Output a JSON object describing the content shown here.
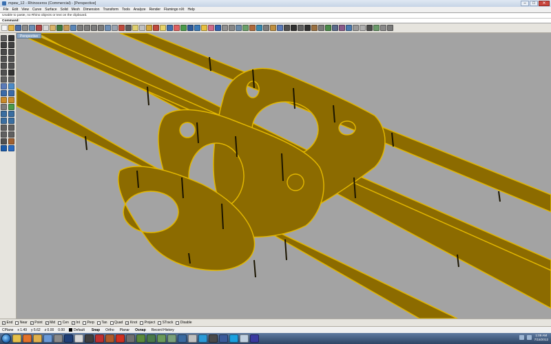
{
  "window": {
    "title": "mpsw_12 - Rhinoceros (Commercial) - [Perspective]",
    "minimize_glyph": "–",
    "maximize_glyph": "□",
    "close_glyph": "✕"
  },
  "menu": [
    "File",
    "Edit",
    "View",
    "Curve",
    "Surface",
    "Solid",
    "Mesh",
    "Dimension",
    "Transform",
    "Tools",
    "Analyze",
    "Render",
    "Flamingo nXt",
    "Help"
  ],
  "command": {
    "history": "Unable to paste, no Rhino objects or text on the clipboard.",
    "prompt": "Command:",
    "value": ""
  },
  "toolbar_top": {
    "icons": [
      {
        "name": "new-icon",
        "color": "#f4f4f4"
      },
      {
        "name": "open-icon",
        "color": "#e4b545"
      },
      {
        "name": "save-icon",
        "color": "#4a6ea8"
      },
      {
        "name": "print-icon",
        "color": "#8a8a8a"
      },
      {
        "name": "import-icon",
        "color": "#6c8fb5"
      },
      {
        "name": "cut-icon",
        "color": "#b04646"
      },
      {
        "name": "copy-icon",
        "color": "#d8d8d8"
      },
      {
        "name": "paste-icon",
        "color": "#d9b46a"
      },
      {
        "name": "undo-icon",
        "color": "#3e7a3e"
      },
      {
        "name": "pan-icon",
        "color": "#c89a56"
      },
      {
        "name": "rotate-view-icon",
        "color": "#5a86b8"
      },
      {
        "name": "zoom-icon",
        "color": "#7c7c7c"
      },
      {
        "name": "zoom-window-icon",
        "color": "#7c7c7c"
      },
      {
        "name": "zoom-extents-icon",
        "color": "#7c7c7c"
      },
      {
        "name": "zoom-selected-icon",
        "color": "#7c7c7c"
      },
      {
        "name": "four-views-icon",
        "color": "#6e8fb6"
      },
      {
        "name": "grid-icon",
        "color": "#9aa4b0"
      },
      {
        "name": "perspective-icon",
        "color": "#c04a3c"
      },
      {
        "name": "select-icon",
        "color": "#5c5c5c"
      },
      {
        "name": "show-icon",
        "color": "#e0d070"
      },
      {
        "name": "hide-icon",
        "color": "#c0c0c0"
      },
      {
        "name": "lock-icon",
        "color": "#d4a83c"
      },
      {
        "name": "layer-icon",
        "color": "#c04a3c"
      },
      {
        "name": "light-icon",
        "color": "#e8d36a"
      },
      {
        "name": "properties-icon",
        "color": "#3f6fb0"
      },
      {
        "name": "color-wheel-icon",
        "color": "#e06060"
      },
      {
        "name": "render-icon",
        "color": "#4a9a4a"
      },
      {
        "name": "material-icon",
        "color": "#2c5a9a"
      },
      {
        "name": "environment-icon",
        "color": "#3a7ab8"
      },
      {
        "name": "sun-icon",
        "color": "#e8c040"
      },
      {
        "name": "flamingo-icon",
        "color": "#d06a8a"
      },
      {
        "name": "help-icon",
        "color": "#2f62b0"
      },
      {
        "name": "options-icon",
        "color": "#909090"
      },
      {
        "name": "osnap-icon",
        "color": "#888888"
      },
      {
        "name": "planar-icon",
        "color": "#6a8aa8"
      },
      {
        "name": "history-icon",
        "color": "#6aa06a"
      },
      {
        "name": "analyze-icon",
        "color": "#b06a3a"
      },
      {
        "name": "curvature-icon",
        "color": "#3a8ab0"
      },
      {
        "name": "mesh-icon",
        "color": "#7c7c7c"
      },
      {
        "name": "solid-icon",
        "color": "#c09040"
      },
      {
        "name": "surface-icon",
        "color": "#5a7ab8"
      },
      {
        "name": "curve-icon",
        "color": "#505050"
      },
      {
        "name": "point-icon",
        "color": "#303030"
      },
      {
        "name": "dimension-icon",
        "color": "#606060"
      },
      {
        "name": "text-icon",
        "color": "#303030"
      },
      {
        "name": "block-icon",
        "color": "#9a7040"
      },
      {
        "name": "group-icon",
        "color": "#7a7a7a"
      },
      {
        "name": "transform-icon",
        "color": "#4a8a4a"
      },
      {
        "name": "array-icon",
        "color": "#5a6a8a"
      },
      {
        "name": "mirror-icon",
        "color": "#8a5a8a"
      },
      {
        "name": "scale-icon",
        "color": "#4a7ab0"
      },
      {
        "name": "align-icon",
        "color": "#9a9a9a"
      },
      {
        "name": "snapshot-icon",
        "color": "#b0b0b0"
      },
      {
        "name": "script-icon",
        "color": "#4c4c4c"
      },
      {
        "name": "plugin-icon",
        "color": "#6a9a6a"
      },
      {
        "name": "toolbar-icon",
        "color": "#8a8a8a"
      },
      {
        "name": "more-icon",
        "color": "#7a7a7a"
      }
    ]
  },
  "toolbar_left": {
    "icons": [
      {
        "name": "select-arrow-icon",
        "color": "#5c5c5c"
      },
      {
        "name": "point-tool-icon",
        "color": "#303030"
      },
      {
        "name": "line-tool-icon",
        "color": "#404040"
      },
      {
        "name": "polyline-tool-icon",
        "color": "#404040"
      },
      {
        "name": "curve-tool-icon",
        "color": "#4a4a4a"
      },
      {
        "name": "freeform-tool-icon",
        "color": "#4a4a4a"
      },
      {
        "name": "circle-tool-icon",
        "color": "#505050"
      },
      {
        "name": "arc-tool-icon",
        "color": "#505050"
      },
      {
        "name": "ellipse-tool-icon",
        "color": "#505050"
      },
      {
        "name": "rectangle-tool-icon",
        "color": "#505050"
      },
      {
        "name": "polygon-tool-icon",
        "color": "#505050"
      },
      {
        "name": "text-tool-icon",
        "color": "#303030"
      },
      {
        "name": "fillet-tool-icon",
        "color": "#606060"
      },
      {
        "name": "offset-tool-icon",
        "color": "#606060"
      },
      {
        "name": "surface-tool-icon",
        "color": "#5a7ab8"
      },
      {
        "name": "loft-tool-icon",
        "color": "#4a8ac8"
      },
      {
        "name": "box-tool-icon",
        "color": "#3a6aa8"
      },
      {
        "name": "sphere-tool-icon",
        "color": "#3a6aa8"
      },
      {
        "name": "extrude-tool-icon",
        "color": "#c88a2a"
      },
      {
        "name": "boolean-tool-icon",
        "color": "#c88a2a"
      },
      {
        "name": "mesh-tool-icon",
        "color": "#7c7c7c"
      },
      {
        "name": "render-tool-icon",
        "color": "#4a9a4a"
      },
      {
        "name": "move-tool-icon",
        "color": "#3a6ea0"
      },
      {
        "name": "copy-tool-icon",
        "color": "#3a6ea0"
      },
      {
        "name": "rotate-tool-icon",
        "color": "#3a6ea0"
      },
      {
        "name": "scale-tool-icon",
        "color": "#3a6ea0"
      },
      {
        "name": "split-tool-icon",
        "color": "#606060"
      },
      {
        "name": "trim-tool-icon",
        "color": "#606060"
      },
      {
        "name": "join-tool-icon",
        "color": "#606060"
      },
      {
        "name": "explode-tool-icon",
        "color": "#606060"
      },
      {
        "name": "dimension-tool-icon",
        "color": "#505050"
      },
      {
        "name": "analyze-tool-icon",
        "color": "#a06030"
      },
      {
        "name": "gear-icon",
        "color": "#1a5aa8"
      },
      {
        "name": "settings-tool-icon",
        "color": "#2a6ac0"
      }
    ]
  },
  "viewport": {
    "label": "Perspective",
    "background": "#a3a3a3",
    "part_color": "#8c6b00",
    "edge_color": "#e2b700"
  },
  "osnap": {
    "items": [
      {
        "label": "End",
        "checked": true
      },
      {
        "label": "Near",
        "checked": false
      },
      {
        "label": "Point",
        "checked": true
      },
      {
        "label": "Mid",
        "checked": true
      },
      {
        "label": "Cen",
        "checked": false
      },
      {
        "label": "Int",
        "checked": true
      },
      {
        "label": "Perp",
        "checked": false
      },
      {
        "label": "Tan",
        "checked": false
      },
      {
        "label": "Quad",
        "checked": false
      },
      {
        "label": "Knot",
        "checked": true
      },
      {
        "label": "Project",
        "checked": false
      },
      {
        "label": "STrack",
        "checked": false
      },
      {
        "label": "Disable",
        "checked": false
      }
    ]
  },
  "status": {
    "cplane": "CPlane",
    "x": "x 1.49",
    "y": "y 5.62",
    "z": "z 0.00",
    "distance": "0.00",
    "layer": "Default",
    "snap": "Snap",
    "ortho": "Ortho",
    "planar": "Planar",
    "osnap": "Osnap",
    "record_history": "Record History"
  },
  "taskbar": {
    "apps": [
      {
        "name": "explorer-taskbar-icon",
        "color": "#e6c04a"
      },
      {
        "name": "firefox-taskbar-icon",
        "color": "#e2722a"
      },
      {
        "name": "folder-taskbar-icon",
        "color": "#e0b04c"
      },
      {
        "name": "media-taskbar-icon",
        "color": "#6a9ad8"
      },
      {
        "name": "rhino-taskbar-icon",
        "color": "#8a8a8a"
      },
      {
        "name": "photoshop-taskbar-icon",
        "color": "#1f3f78"
      },
      {
        "name": "paint-taskbar-icon",
        "color": "#d8d8d8"
      },
      {
        "name": "game-taskbar-icon",
        "color": "#404040"
      },
      {
        "name": "app-taskbar-icon-1",
        "color": "#c03030"
      },
      {
        "name": "app-taskbar-icon-2",
        "color": "#b05a2a"
      },
      {
        "name": "app-taskbar-icon-3",
        "color": "#d03020"
      },
      {
        "name": "app-taskbar-icon-4",
        "color": "#707070"
      },
      {
        "name": "app-taskbar-icon-5",
        "color": "#5a8a3a"
      },
      {
        "name": "app-taskbar-icon-6",
        "color": "#4a7a4a"
      },
      {
        "name": "app-taskbar-icon-7",
        "color": "#6a9a5a"
      },
      {
        "name": "app-taskbar-icon-8",
        "color": "#7aa07a"
      },
      {
        "name": "app-taskbar-icon-9",
        "color": "#3a6aa0"
      },
      {
        "name": "app-taskbar-icon-10",
        "color": "#c0c0c0"
      },
      {
        "name": "app-taskbar-icon-11",
        "color": "#2a9ad8"
      },
      {
        "name": "app-taskbar-icon-12",
        "color": "#4a4a4a"
      },
      {
        "name": "app-taskbar-icon-13",
        "color": "#3a5a9a"
      },
      {
        "name": "skype-taskbar-icon",
        "color": "#1aa0e0"
      },
      {
        "name": "app-taskbar-icon-14",
        "color": "#c0d0e0"
      },
      {
        "name": "app-taskbar-icon-15",
        "color": "#3a3aa0"
      }
    ],
    "time": "1:09 AM",
    "date": "7/15/2012"
  }
}
